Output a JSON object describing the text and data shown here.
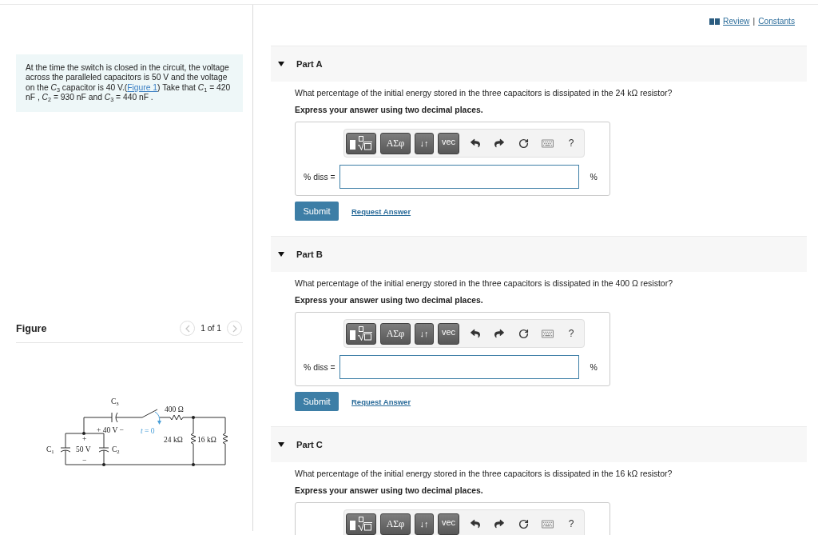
{
  "problem": {
    "text_before": "At the time the switch is closed in the circuit, the voltage across the paralleled capacitors is 50 V and the voltage on the *C*$_{3}$ capacitor is 40 V.(",
    "figure_link": "Figure 1",
    "text_after": ") Take that *C*$_{1}$ = 420 nF , *C*$_{2}$ = 930 nF and *C*$_{3}$ = 440 nF ."
  },
  "figure": {
    "heading": "Figure",
    "pager": {
      "text": "1 of 1",
      "prev_disabled": true,
      "next_disabled": true
    },
    "labels": [
      {
        "text": "C$_{3}$",
        "kind": "component"
      },
      {
        "text": "400 Ω",
        "kind": "component"
      },
      {
        "text": "+ 40 V −",
        "kind": "component"
      },
      {
        "text": "*t* = 0",
        "kind": "switch"
      },
      {
        "text": "24 kΩ",
        "kind": "component"
      },
      {
        "text": "16 kΩ",
        "kind": "component"
      },
      {
        "text": "C$_{1}$",
        "kind": "component"
      },
      {
        "text": "50 V",
        "kind": "component"
      },
      {
        "text": "C$_{2}$",
        "kind": "component"
      },
      {
        "text": "+",
        "kind": "component"
      },
      {
        "text": "−",
        "kind": "component"
      }
    ]
  },
  "header_links": {
    "review": "Review",
    "separator": "|",
    "constants": "Constants"
  },
  "parts": [
    {
      "title": "Part A",
      "expanded": true,
      "question": "What percentage of the initial energy stored in the three capacitors is dissipated in the 24 kΩ resistor?",
      "instruction": "Express your answer using two decimal places.",
      "toolbar": {
        "symbols": "ΑΣφ",
        "arrows": "↓↑",
        "vector": "vec",
        "help": "?"
      },
      "answer": {
        "label": "% diss =",
        "unit": "%"
      },
      "submit": "Submit",
      "request_answer": "Request Answer"
    },
    {
      "title": "Part B",
      "expanded": true,
      "question": "What percentage of the initial energy stored in the three capacitors is dissipated in the 400 Ω resistor?",
      "instruction": "Express your answer using two decimal places.",
      "toolbar": {
        "symbols": "ΑΣφ",
        "arrows": "↓↑",
        "vector": "vec",
        "help": "?"
      },
      "answer": {
        "label": "% diss =",
        "unit": "%"
      },
      "submit": "Submit",
      "request_answer": "Request Answer"
    },
    {
      "title": "Part C",
      "expanded": true,
      "question": "What percentage of the initial energy stored in the three capacitors is dissipated in the 16 kΩ resistor?",
      "instruction": "Express your answer using two decimal places.",
      "toolbar": {
        "symbols": "ΑΣφ",
        "arrows": "↓↑",
        "vector": "vec",
        "help": "?"
      }
    }
  ]
}
